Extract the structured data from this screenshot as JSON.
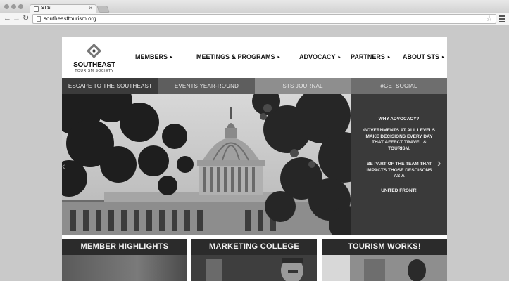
{
  "browser": {
    "tab_title": "STS",
    "tab_close": "×",
    "url": "southeasttourism.org",
    "back_icon": "back-arrow-icon",
    "forward_icon": "forward-arrow-icon",
    "reload_icon": "reload-icon",
    "star_icon": "star-icon",
    "menu_icon": "hamburger-menu-icon"
  },
  "logo": {
    "name": "SOUTHEAST",
    "subtitle": "TOURISM SOCIETY"
  },
  "nav": {
    "members": "MEMBERS",
    "meetings": "MEETINGS & PROGRAMS",
    "advocacy": "ADVOCACY",
    "partners": "PARTNERS",
    "about": "ABOUT STS",
    "arrow": "▸"
  },
  "subnav": [
    {
      "label": "ESCAPE TO THE SOUTHEAST",
      "color": "#3b3b3b"
    },
    {
      "label": "EVENTS YEAR-ROUND",
      "color": "#5e5e5e"
    },
    {
      "label": "STS JOURNAL",
      "color": "#8e8e8e"
    },
    {
      "label": "#GETSOCIAL",
      "color": "#6e6e6e"
    }
  ],
  "hero": {
    "prev": "‹",
    "next": "›"
  },
  "advocacy_panel": {
    "title": "WHY ADVOCACY?",
    "p1": "GOVERNMENTS AT ALL LEVELS MAKE DECISIONS EVERY DAY THAT AFFECT TRAVEL & TOURISM.",
    "p2": "BE PART OF THE TEAM THAT IMPACTS THOSE DESCISONS AS A",
    "p3": "UNITED FRONT!"
  },
  "cards": [
    {
      "title": "MEMBER HIGHLIGHTS"
    },
    {
      "title": "MARKETING COLLEGE"
    },
    {
      "title": "TOURISM WORKS!"
    }
  ]
}
